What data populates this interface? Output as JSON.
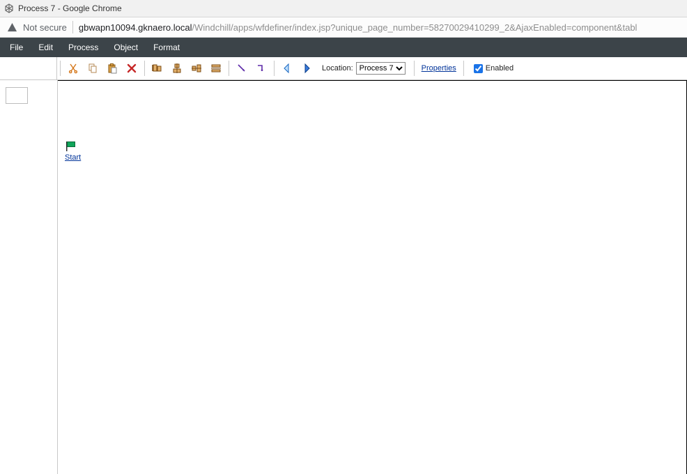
{
  "chrome": {
    "title": "Process 7 - Google Chrome",
    "not_secure_label": "Not secure",
    "url_host": "gbwapn10094.gknaero.local",
    "url_path": "/Windchill/apps/wfdefiner/index.jsp?unique_page_number=58270029410299_2&AjaxEnabled=component&tabl"
  },
  "menu": {
    "file": "File",
    "edit": "Edit",
    "process": "Process",
    "object": "Object",
    "format": "Format"
  },
  "toolbar": {
    "location_label": "Location:",
    "location_value": "Process 7",
    "properties_link": "Properties",
    "enabled_label": "Enabled",
    "enabled_checked": true,
    "icons": {
      "cut": "cut-icon",
      "copy": "copy-icon",
      "paste": "paste-icon",
      "delete": "delete-icon",
      "align_left": "align-left-icon",
      "align_center_h": "align-center-h-icon",
      "align_center_v": "align-center-v-icon",
      "align_right": "distributed-icon",
      "connector_diag": "connector-diag-icon",
      "connector_ortho": "connector-ortho-icon",
      "nav_back": "nav-back-icon",
      "nav_forward": "nav-forward-icon"
    }
  },
  "canvas": {
    "start_node_label": "Start"
  }
}
